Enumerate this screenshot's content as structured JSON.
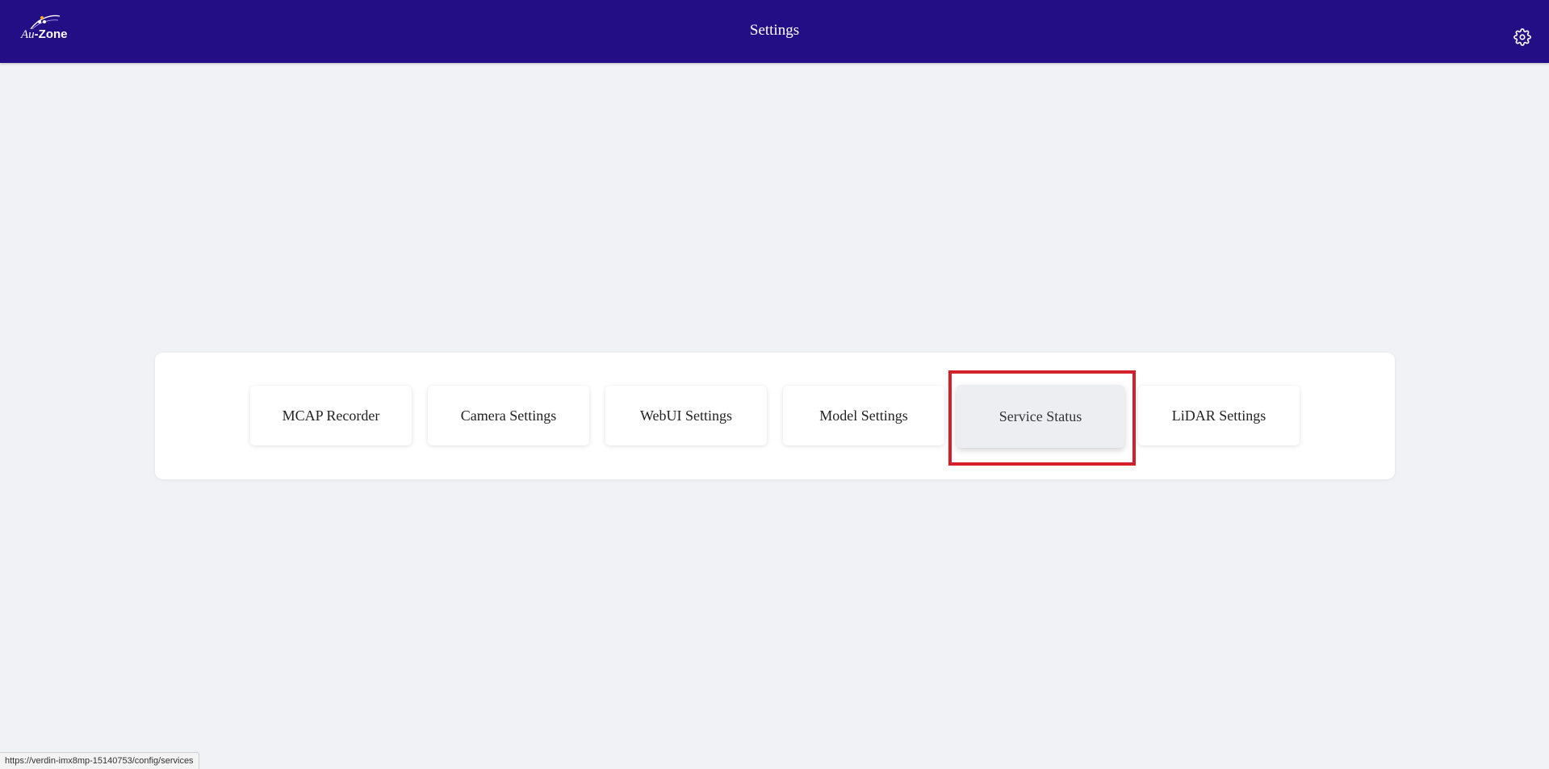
{
  "header": {
    "title": "Settings",
    "logo": {
      "part1": "Au",
      "part2": "-Zone"
    },
    "settings_icon": "gear-icon",
    "background_color": "#240e85"
  },
  "settings_menu": {
    "items": [
      {
        "label": "MCAP Recorder"
      },
      {
        "label": "Camera Settings"
      },
      {
        "label": "WebUI Settings"
      },
      {
        "label": "Model Settings"
      },
      {
        "label": "Service Status",
        "state": "hovered"
      },
      {
        "label": "LiDAR Settings"
      }
    ]
  },
  "highlight_color": "#d4202b",
  "status_bar": {
    "url": "https://verdin-imx8mp-15140753/config/services"
  }
}
